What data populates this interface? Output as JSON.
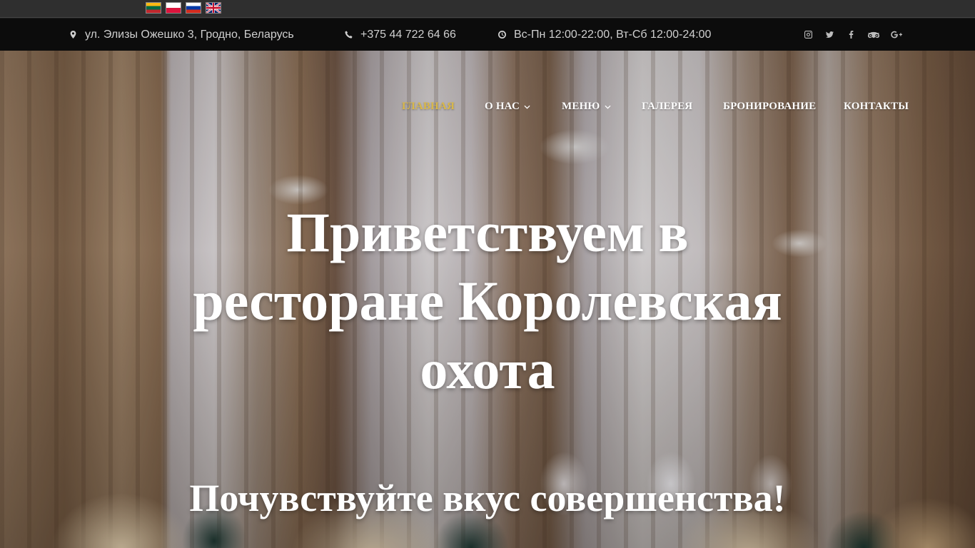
{
  "languages": [
    {
      "code": "lt",
      "icon": "lithuania-flag-icon"
    },
    {
      "code": "pl",
      "icon": "poland-flag-icon"
    },
    {
      "code": "ru",
      "icon": "russia-flag-icon"
    },
    {
      "code": "en",
      "icon": "uk-flag-icon"
    }
  ],
  "contacts": {
    "address": "ул. Элизы Ожешко 3, Гродно, Беларусь",
    "phone": "+375 44 722 64 66",
    "hours": "Вс-Пн 12:00-22:00, Вт-Сб 12:00-24:00"
  },
  "social": [
    "instagram-icon",
    "twitter-icon",
    "facebook-icon",
    "tripadvisor-icon",
    "google-plus-icon"
  ],
  "nav": {
    "items": [
      {
        "label": "ГЛАВНАЯ",
        "active": true
      },
      {
        "label": "О НАС",
        "dropdown": true
      },
      {
        "label": "МЕНЮ",
        "dropdown": true
      },
      {
        "label": "ГАЛЕРЕЯ"
      },
      {
        "label": "БРОНИРОВАНИЕ"
      },
      {
        "label": "КОНТАКТЫ"
      }
    ],
    "active_color": "#d9b84a"
  },
  "hero": {
    "title": "Приветствуем в ресторане Королевская охота",
    "subtitle": "Почувствуйте вкус совершенства!"
  }
}
